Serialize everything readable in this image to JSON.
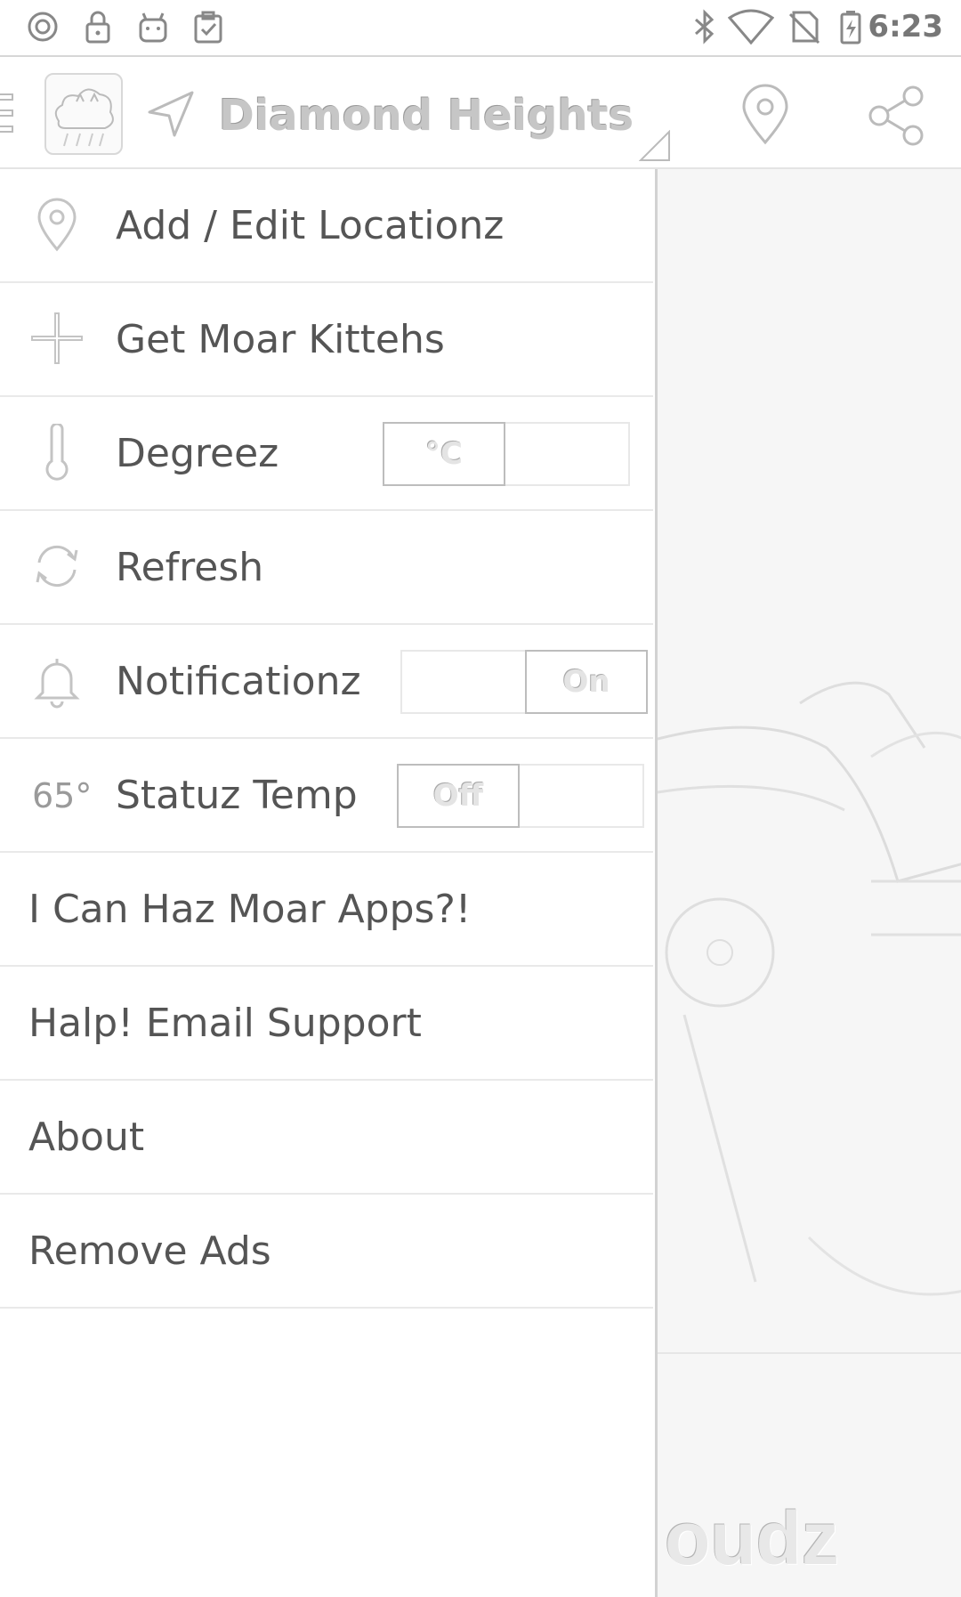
{
  "status_bar": {
    "time": "6:23",
    "left_icons": [
      "circle-icon",
      "lock-icon",
      "android-icon",
      "clipboard-check-icon"
    ],
    "right_icons": [
      "bluetooth-icon",
      "wifi-icon",
      "no-sim-icon",
      "battery-charging-icon"
    ]
  },
  "app_bar": {
    "location": "Diamond Heights Villa..."
  },
  "drawer": {
    "add_edit_locations": "Add / Edit Locationz",
    "get_more_kittehs": "Get Moar Kittehs",
    "degrees": {
      "label": "Degreez",
      "toggle": "°C"
    },
    "refresh": "Refresh",
    "notifications": {
      "label": "Notificationz",
      "toggle": "On"
    },
    "status_temp": {
      "label": "Statuz Temp",
      "icon_text": "65°",
      "toggle": "Off"
    },
    "more_apps": "I Can Haz Moar Apps?!",
    "email_support": "Halp! Email Support",
    "about": "About",
    "remove_ads": "Remove Ads"
  },
  "background": {
    "partial_text": "oudz"
  }
}
